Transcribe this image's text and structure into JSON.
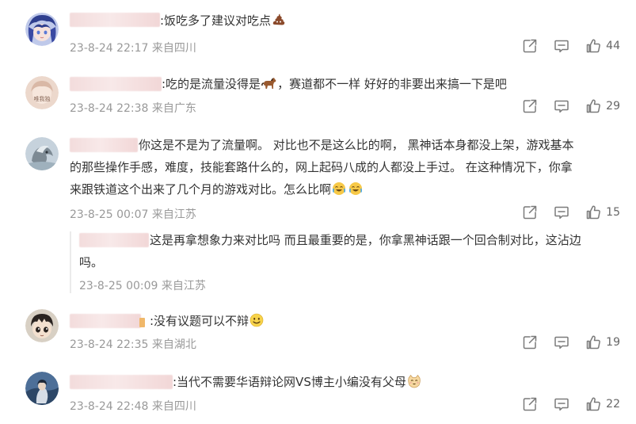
{
  "comments": [
    {
      "text": ":饭吃多了建议对吃点",
      "emoji": "poop-emoji",
      "time": "23-8-24 22:17",
      "location": "来自四川",
      "likes": "44"
    },
    {
      "text": ":吃的是流量没得是",
      "text_after_emoji": "，赛道都不一样 好好的非要出来搞一下是吧",
      "emoji": "horse-emoji",
      "avatar_text": "唯我独",
      "time": "23-8-24 22:38",
      "location": "来自广东",
      "likes": "29"
    },
    {
      "line1": "你这是不是为了流量啊。 对比也不是这么比的啊， 黑神话本身都没上架，游戏基本",
      "line2": "的那些操作手感，难度，技能套路什么的，网上起码八成的人都没上手过。 在这种情况下，你拿",
      "line3": "来跟铁道这个出来了几个月的游戏对比。怎么比啊",
      "emoji": "crying-laughing-emoji",
      "time": "23-8-25 00:07",
      "location": "来自江苏",
      "likes": "15",
      "reply": {
        "line1": "这是再拿想象力来对比吗 而且最重要的是，你拿黑神话跟一个回合制对比，这沾边",
        "line2": "吗。",
        "time": "23-8-25 00:09",
        "location": "来自江苏"
      }
    },
    {
      "text": ":没有议题可以不辩",
      "emoji": "smile-emoji",
      "time": "23-8-24 22:35",
      "location": "来自湖北",
      "likes": "19"
    },
    {
      "text": ":当代不需要华语辩论网VS博主小编没有父母",
      "emoji": "cat-emoji",
      "time": "23-8-24 22:48",
      "location": "来自四川",
      "likes": "22"
    }
  ],
  "colors": {
    "text": "#333333",
    "meta": "#999999",
    "icon": "#7a7a7a",
    "name_blur": "#f3dcdc"
  }
}
